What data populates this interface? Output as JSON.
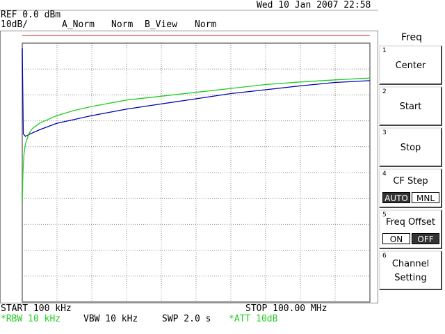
{
  "header": {
    "datetime": "Wed 10 Jan 2007 22:58",
    "ref_level": "REF 0.0 dBm",
    "scale": "10dB/",
    "trace_a": "A_Norm",
    "detector": "Norm",
    "trace_b": "B_View",
    "detector_b": "Norm"
  },
  "footer": {
    "start": "START 100 kHz",
    "stop": "STOP 100.00 MHz",
    "rbw": "*RBW 10 kHz",
    "vbw": "VBW 10 kHz",
    "swp": "SWP 2.0 s",
    "att": "*ATT 10dB"
  },
  "panel": {
    "title": "Freq",
    "keys": [
      {
        "num": "1",
        "label": "Center"
      },
      {
        "num": "2",
        "label": "Start"
      },
      {
        "num": "3",
        "label": "Stop"
      },
      {
        "num": "4",
        "label": "CF Step",
        "opt_a": "AUTO",
        "opt_b": "MNL"
      },
      {
        "num": "5",
        "label": "Freq Offset",
        "opt_a": "ON",
        "opt_b": "OFF"
      },
      {
        "num": "6",
        "label": "Channel",
        "label2": "Setting"
      }
    ]
  },
  "colors": {
    "trace_a": "#0000aa",
    "trace_b": "#22cc22",
    "ref_line": "#cc2222",
    "grid": "#888888"
  },
  "chart_data": {
    "type": "line",
    "xlim_mhz": [
      0.1,
      100.0
    ],
    "ylim_db": [
      0,
      -100
    ],
    "grid": true,
    "series": [
      {
        "name": "A_Norm",
        "color": "#0000aa",
        "x": [
          0.1,
          0.4,
          1.0,
          2.5,
          5,
          10,
          15,
          20,
          30,
          40,
          50,
          60,
          70,
          80,
          90,
          100
        ],
        "y": [
          -2,
          -35,
          -36,
          -35,
          -33.5,
          -31,
          -29.5,
          -28,
          -25.5,
          -23.5,
          -21.5,
          -19.5,
          -18,
          -16.5,
          -15.2,
          -14.5
        ]
      },
      {
        "name": "B_View",
        "color": "#22cc22",
        "x": [
          0.1,
          0.3,
          0.6,
          1.0,
          2.0,
          3.0,
          5,
          7.5,
          10,
          15,
          20,
          30,
          40,
          50,
          60,
          70,
          80,
          90,
          100
        ],
        "y": [
          -61,
          -50,
          -43,
          -39,
          -35,
          -33,
          -31,
          -29.5,
          -28,
          -26,
          -24.5,
          -22,
          -20.5,
          -19,
          -17.5,
          -16,
          -15,
          -14.2,
          -13.5
        ]
      }
    ]
  }
}
